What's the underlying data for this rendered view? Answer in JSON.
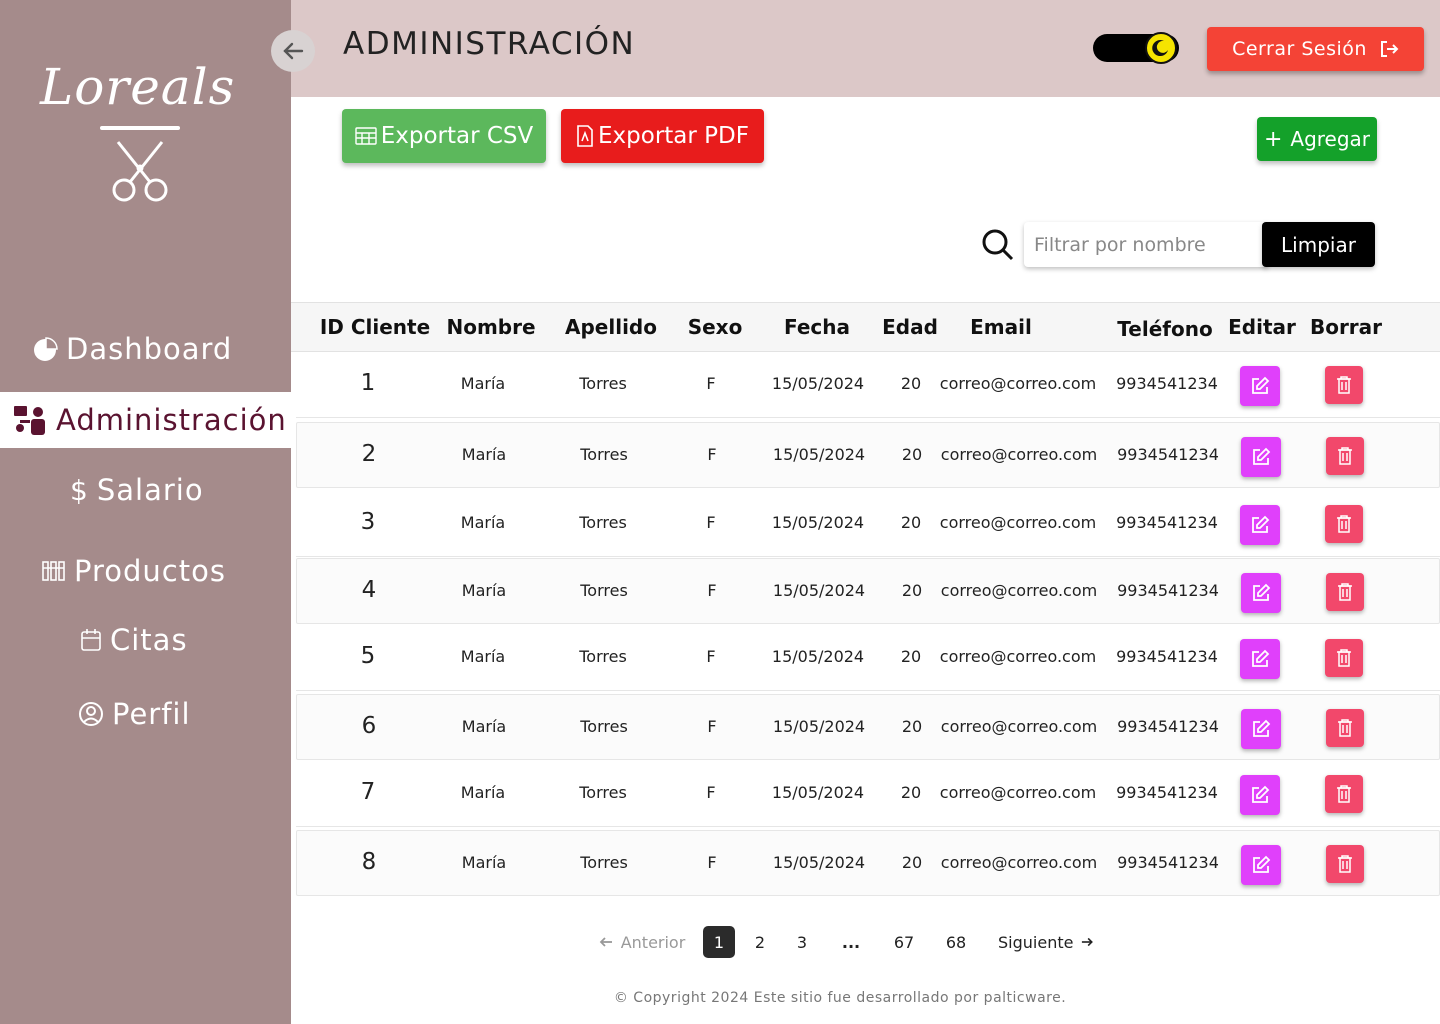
{
  "sidebar": {
    "logo_text": "Loreals",
    "items": [
      {
        "label": "Dashboard",
        "icon": "pie-chart-icon"
      },
      {
        "label": "Administración",
        "icon": "admin-users-icon",
        "active": true
      },
      {
        "label": "Salario",
        "icon": "dollar-icon"
      },
      {
        "label": "Productos",
        "icon": "products-icon"
      },
      {
        "label": "Citas",
        "icon": "calendar-icon"
      },
      {
        "label": "Perfil",
        "icon": "user-circle-icon"
      }
    ]
  },
  "header": {
    "title": "ADMINISTRACIÓN",
    "logout_label": "Cerrar Sesión",
    "theme_toggle_icon": "moon-icon"
  },
  "toolbar": {
    "export_csv_label": "Exportar CSV",
    "export_pdf_label": "Exportar PDF",
    "add_label": "Agregar"
  },
  "search": {
    "placeholder": "Filtrar por nombre",
    "value": "",
    "clear_label": "Limpiar"
  },
  "table": {
    "columns": [
      "ID Cliente",
      "Nombre",
      "Apellido",
      "Sexo",
      "Fecha",
      "Edad",
      "Email",
      "Teléfono",
      "Editar",
      "Borrar"
    ],
    "rows": [
      {
        "id": "1",
        "nombre": "María",
        "apellido": "Torres",
        "sexo": "F",
        "fecha": "15/05/2024",
        "edad": "20",
        "email": "correo@correo.com",
        "telefono": "9934541234"
      },
      {
        "id": "2",
        "nombre": "María",
        "apellido": "Torres",
        "sexo": "F",
        "fecha": "15/05/2024",
        "edad": "20",
        "email": "correo@correo.com",
        "telefono": "9934541234"
      },
      {
        "id": "3",
        "nombre": "María",
        "apellido": "Torres",
        "sexo": "F",
        "fecha": "15/05/2024",
        "edad": "20",
        "email": "correo@correo.com",
        "telefono": "9934541234"
      },
      {
        "id": "4",
        "nombre": "María",
        "apellido": "Torres",
        "sexo": "F",
        "fecha": "15/05/2024",
        "edad": "20",
        "email": "correo@correo.com",
        "telefono": "9934541234"
      },
      {
        "id": "5",
        "nombre": "María",
        "apellido": "Torres",
        "sexo": "F",
        "fecha": "15/05/2024",
        "edad": "20",
        "email": "correo@correo.com",
        "telefono": "9934541234"
      },
      {
        "id": "6",
        "nombre": "María",
        "apellido": "Torres",
        "sexo": "F",
        "fecha": "15/05/2024",
        "edad": "20",
        "email": "correo@correo.com",
        "telefono": "9934541234"
      },
      {
        "id": "7",
        "nombre": "María",
        "apellido": "Torres",
        "sexo": "F",
        "fecha": "15/05/2024",
        "edad": "20",
        "email": "correo@correo.com",
        "telefono": "9934541234"
      },
      {
        "id": "8",
        "nombre": "María",
        "apellido": "Torres",
        "sexo": "F",
        "fecha": "15/05/2024",
        "edad": "20",
        "email": "correo@correo.com",
        "telefono": "9934541234"
      }
    ]
  },
  "pagination": {
    "prev_label": "Anterior",
    "next_label": "Siguiente",
    "pages": [
      "1",
      "2",
      "3",
      "...",
      "67",
      "68"
    ],
    "current": "1"
  },
  "footer": {
    "copyright": "© Copyright 2024 Este sitio fue desarrollado por palticware."
  },
  "colors": {
    "sidebar_bg": "#a58b8b",
    "header_bg": "#dcc8c8",
    "active_text": "#5a1330",
    "csv_green": "#5cb85c",
    "pdf_red": "#e81c1c",
    "add_green": "#14a12a",
    "logout_red": "#f44336",
    "edit_magenta": "#e040fb",
    "delete_pink": "#f2486b"
  }
}
